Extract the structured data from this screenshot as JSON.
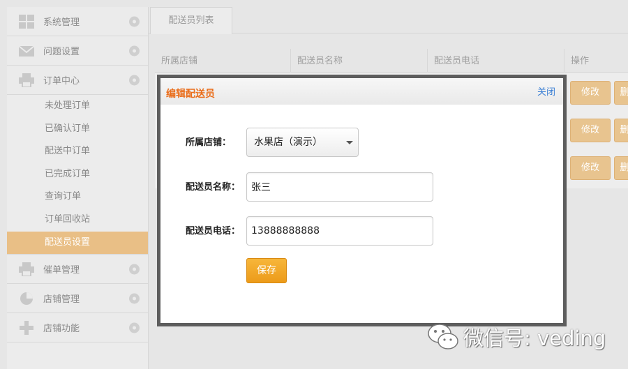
{
  "sidebar": {
    "groups": [
      {
        "label": "系统管理",
        "icon": "grid-icon"
      },
      {
        "label": "问题设置",
        "icon": "mail-icon"
      },
      {
        "label": "订单中心",
        "icon": "printer-icon"
      }
    ],
    "sub_items": [
      {
        "label": "未处理订单"
      },
      {
        "label": "已确认订单"
      },
      {
        "label": "配送中订单"
      },
      {
        "label": "已完成订单"
      },
      {
        "label": "查询订单"
      },
      {
        "label": "订单回收站"
      },
      {
        "label": "配送员设置"
      }
    ],
    "bottom_groups": [
      {
        "label": "催单管理",
        "icon": "printer-icon"
      },
      {
        "label": "店铺管理",
        "icon": "pie-chart-icon"
      },
      {
        "label": "店铺功能",
        "icon": "plus-icon"
      }
    ]
  },
  "tabs": [
    {
      "label": "配送员列表"
    }
  ],
  "table": {
    "headers": [
      "所属店铺",
      "配送员名称",
      "配送员电话",
      "操作"
    ],
    "row_actions": [
      {
        "edit": "修改",
        "delete": "删"
      },
      {
        "edit": "修改",
        "delete": "删"
      },
      {
        "edit": "修改",
        "delete": "删"
      }
    ]
  },
  "modal": {
    "title": "编辑配送员",
    "close_label": "关闭",
    "store_label": "所属店铺：",
    "store_value": "水果店（演示）",
    "name_label": "配送员名称：",
    "name_value": "张三",
    "phone_label": "配送员电话：",
    "phone_value": "13888888888",
    "save_label": "保存"
  },
  "watermark": {
    "text": "微信号: veding"
  },
  "colors": {
    "accent_orange": "#ec9b1a",
    "active_menu": "#e9bf86",
    "title_orange": "#ea6d1a",
    "link_blue": "#3a7fd5"
  }
}
